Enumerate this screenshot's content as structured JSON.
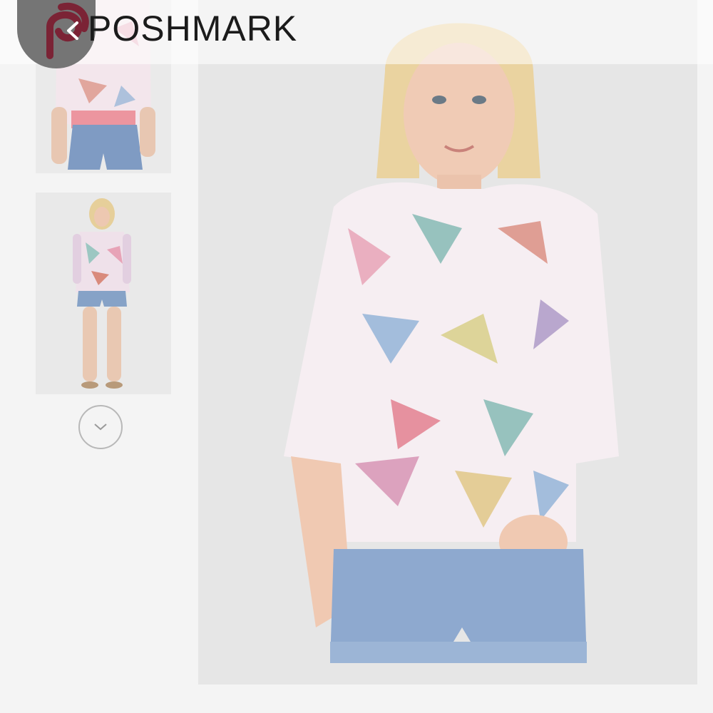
{
  "header": {
    "brand_name": "POSHMARK",
    "logo_icon": "poshmark-logo-icon",
    "back_icon": "chevron-left-icon"
  },
  "gallery": {
    "thumbnails": [
      {
        "name": "thumbnail-1",
        "description_icon": "product-photo-icon"
      },
      {
        "name": "thumbnail-2",
        "description_icon": "product-photo-icon"
      }
    ],
    "more_icon": "chevron-down-icon"
  },
  "main_image": {
    "icon": "product-photo-icon"
  },
  "colors": {
    "brand": "#7b2335",
    "background": "#f2f2f2",
    "photo_background": "#e6e6e6"
  }
}
